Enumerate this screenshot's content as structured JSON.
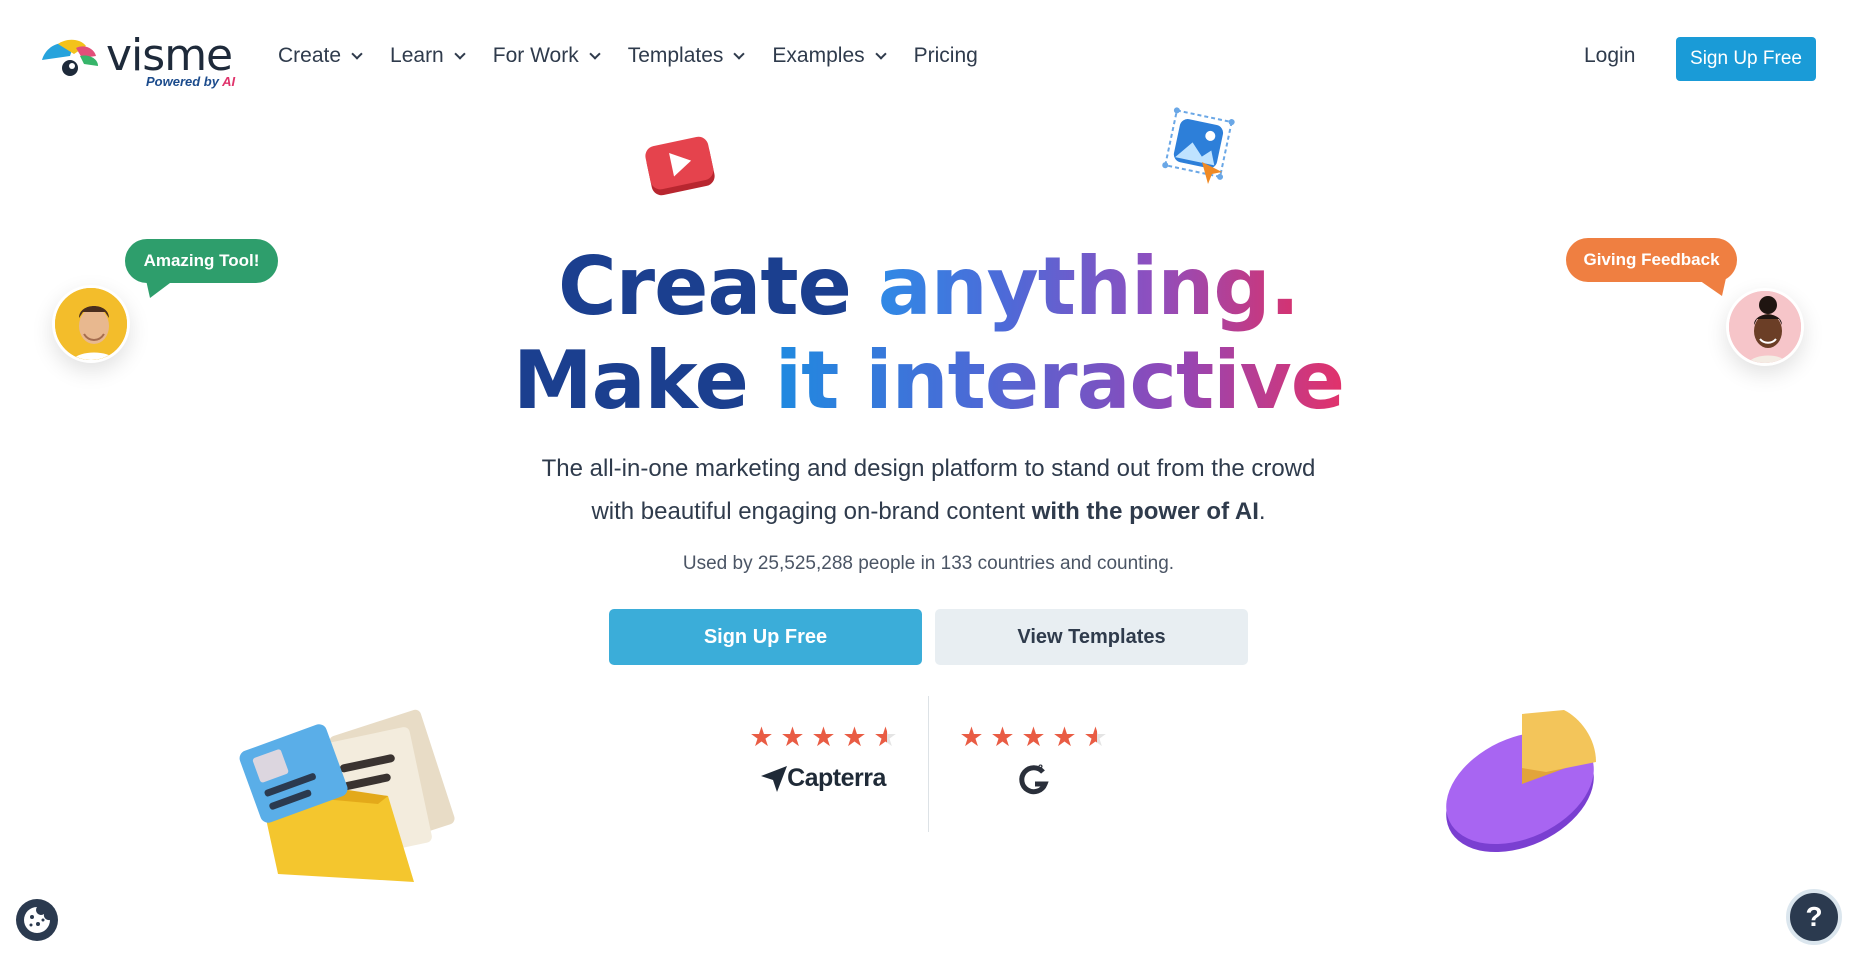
{
  "nav": {
    "logo": {
      "word": "visme",
      "sub_prefix": "Powered by ",
      "sub_ai": "AI"
    },
    "items": [
      {
        "label": "Create",
        "icon": "chevron-down-icon"
      },
      {
        "label": "Learn",
        "icon": "chevron-down-icon"
      },
      {
        "label": "For Work",
        "icon": "chevron-down-icon"
      },
      {
        "label": "Templates",
        "icon": "chevron-down-icon"
      },
      {
        "label": "Examples",
        "icon": "chevron-down-icon"
      },
      {
        "label": "Pricing"
      }
    ],
    "login": "Login",
    "signup": "Sign Up Free"
  },
  "hero": {
    "line1_a": "Create ",
    "line1_b": "anything.",
    "line2_a": "Make ",
    "line2_b": "it interactive",
    "sub_line1": "The all-in-one marketing and design platform to stand out from the crowd",
    "sub_line2_a": "with beautiful engaging on-brand content ",
    "sub_line2_bold": "with the power of AI",
    "sub_line2_end": ".",
    "used_by": "Used by 25,525,288 people in 133 countries and counting.",
    "cta_primary": "Sign Up Free",
    "cta_secondary": "View Templates"
  },
  "ratings": [
    {
      "source": "Capterra",
      "stars": 4.5,
      "logo_text": "Capterra"
    },
    {
      "source": "G2",
      "stars": 4.5,
      "logo_text": "G2"
    }
  ],
  "bubbles": {
    "left": "Amazing Tool!",
    "right": "Giving Feedback"
  },
  "colors": {
    "primary_button": "#1a9bd7",
    "cta_button": "#3badd9",
    "title_dark": "#1b3f8f",
    "star": "#e95c44",
    "bubble_green": "#2e9e6c",
    "bubble_orange": "#ef7f41"
  },
  "widgets": {
    "help_label": "?",
    "cookie_icon": "cookie-icon"
  }
}
